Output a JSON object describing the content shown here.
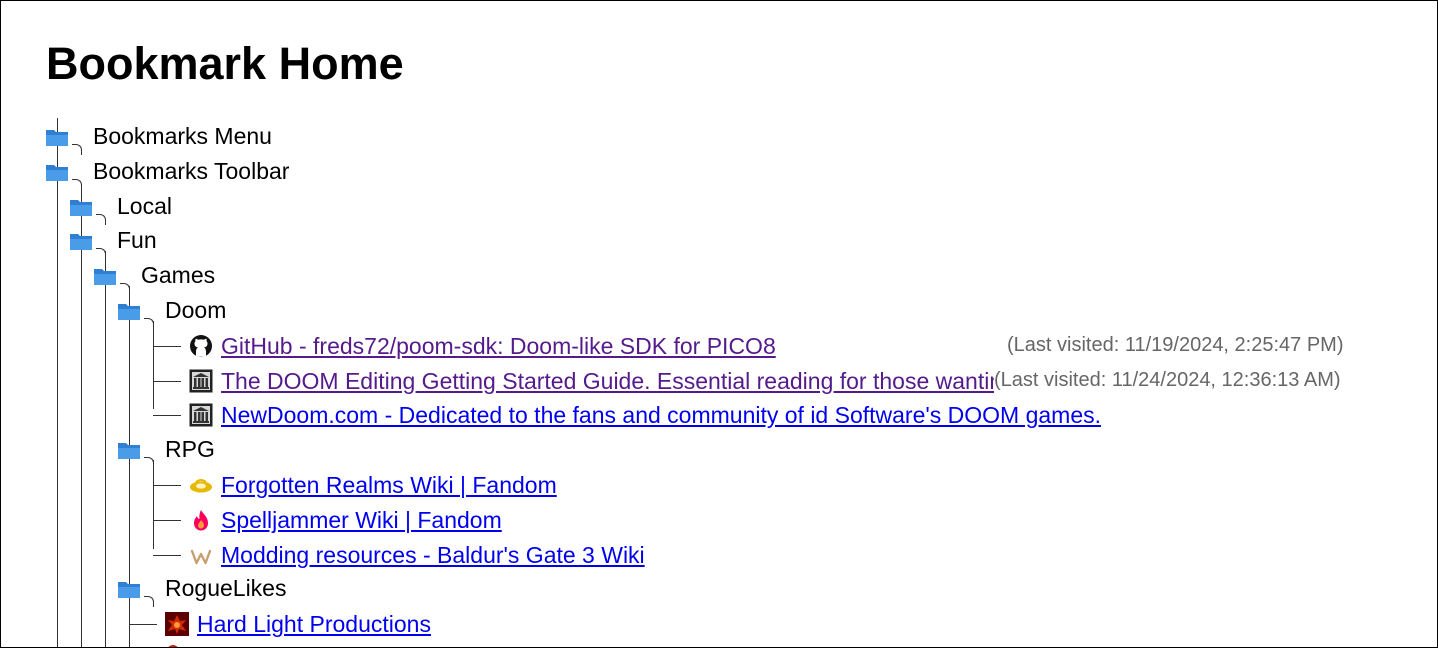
{
  "page": {
    "title": "Bookmark Home"
  },
  "colors": {
    "folder": "#4a9be8",
    "visited_link": "#551a8b",
    "unvisited_link": "#0000ee",
    "visit_text": "#666666"
  },
  "tree": {
    "bookmarks_menu": {
      "label": "Bookmarks Menu"
    },
    "bookmarks_toolbar": {
      "label": "Bookmarks Toolbar",
      "local": {
        "label": "Local"
      },
      "fun": {
        "label": "Fun",
        "games": {
          "label": "Games",
          "doom": {
            "label": "Doom",
            "links": [
              {
                "title": "GitHub - freds72/poom-sdk: Doom-like SDK for PICO8",
                "icon": "github-icon",
                "visited": "(Last visited: 11/19/2024, 2:25:47 PM)"
              },
              {
                "title": "The DOOM Editing Getting Started Guide. Essential reading for those wanting to get into Doom editing.",
                "icon": "pillars-icon",
                "visited": "(Last visited: 11/24/2024, 12:36:13 AM)"
              },
              {
                "title": "NewDoom.com - Dedicated to the fans and community of id Software's DOOM games.",
                "icon": "pillars-icon"
              }
            ]
          },
          "rpg": {
            "label": "RPG",
            "links": [
              {
                "title": "Forgotten Realms Wiki | Fandom",
                "icon": "forgotten-realms-icon"
              },
              {
                "title": "Spelljammer Wiki | Fandom",
                "icon": "fandom-flame-icon"
              },
              {
                "title": "Modding resources - Baldur's Gate 3 Wiki",
                "icon": "wiki-w-icon"
              }
            ]
          },
          "roguelikes": {
            "label": "RogueLikes",
            "links": [
              {
                "title": "Hard Light Productions",
                "icon": "hard-light-icon"
              }
            ]
          }
        }
      }
    }
  }
}
